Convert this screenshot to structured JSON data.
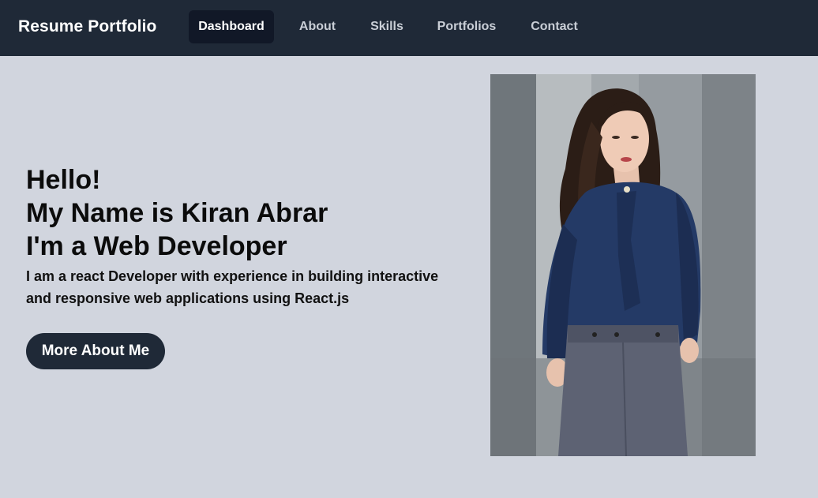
{
  "navbar": {
    "brand": "Resume Portfolio",
    "items": [
      {
        "label": "Dashboard",
        "active": true
      },
      {
        "label": "About",
        "active": false
      },
      {
        "label": "Skills",
        "active": false
      },
      {
        "label": "Portfolios",
        "active": false
      },
      {
        "label": "Contact",
        "active": false
      }
    ]
  },
  "hero": {
    "greeting": "Hello!",
    "name_line": "My Name is Kiran Abrar",
    "role_line": "I'm a Web Developer",
    "intro": "I am a react Developer with experience in building interactive and responsive web applications using React.js",
    "cta_label": "More About Me",
    "photo_icon": "profile-photo"
  },
  "colors": {
    "navbar_bg": "#1f2937",
    "active_tab_bg": "#111827",
    "page_bg": "#d1d5de",
    "button_bg": "#1f2937"
  }
}
